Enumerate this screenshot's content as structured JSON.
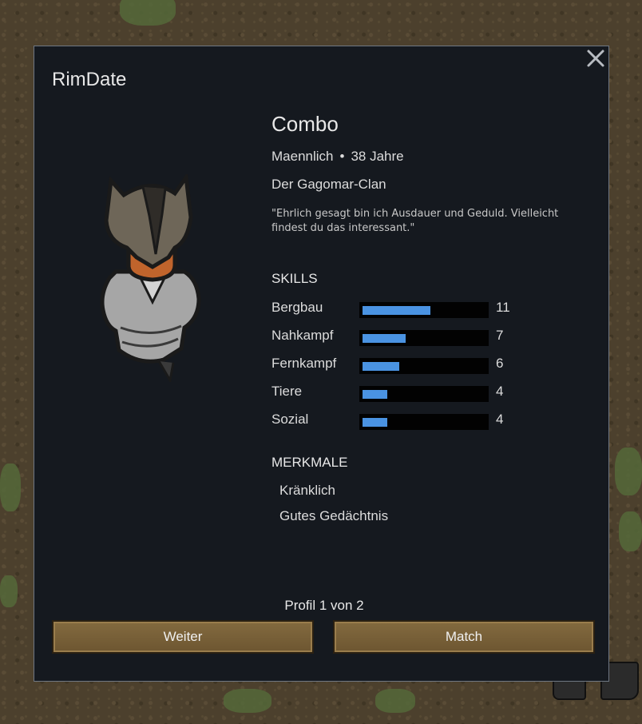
{
  "dialog": {
    "title": "RimDate",
    "close_icon": "close-icon"
  },
  "profile": {
    "name": "Combo",
    "gender": "Maennlich",
    "separator": "•",
    "age": "38 Jahre",
    "faction": "Der Gagomar-Clan",
    "quote": "\"Ehrlich gesagt bin ich Ausdauer und Geduld. Vielleicht findest du das interessant.\""
  },
  "skills": {
    "heading": "SKILLS",
    "max_level": 20,
    "items": [
      {
        "label": "Bergbau",
        "value": "11",
        "level": 11
      },
      {
        "label": "Nahkampf",
        "value": "7",
        "level": 7
      },
      {
        "label": "Fernkampf",
        "value": "6",
        "level": 6
      },
      {
        "label": "Tiere",
        "value": "4",
        "level": 4
      },
      {
        "label": "Sozial",
        "value": "4",
        "level": 4
      }
    ],
    "bar_color": "#4a93e2"
  },
  "traits": {
    "heading": "MERKMALE",
    "items": [
      "Kränklich",
      "Gutes Gedächtnis"
    ]
  },
  "footer": {
    "profile_count": "Profil 1 von 2",
    "next_label": "Weiter",
    "match_label": "Match"
  },
  "colors": {
    "panel": "#15191f",
    "button": "#7a6239",
    "accent": "#4a93e2"
  }
}
